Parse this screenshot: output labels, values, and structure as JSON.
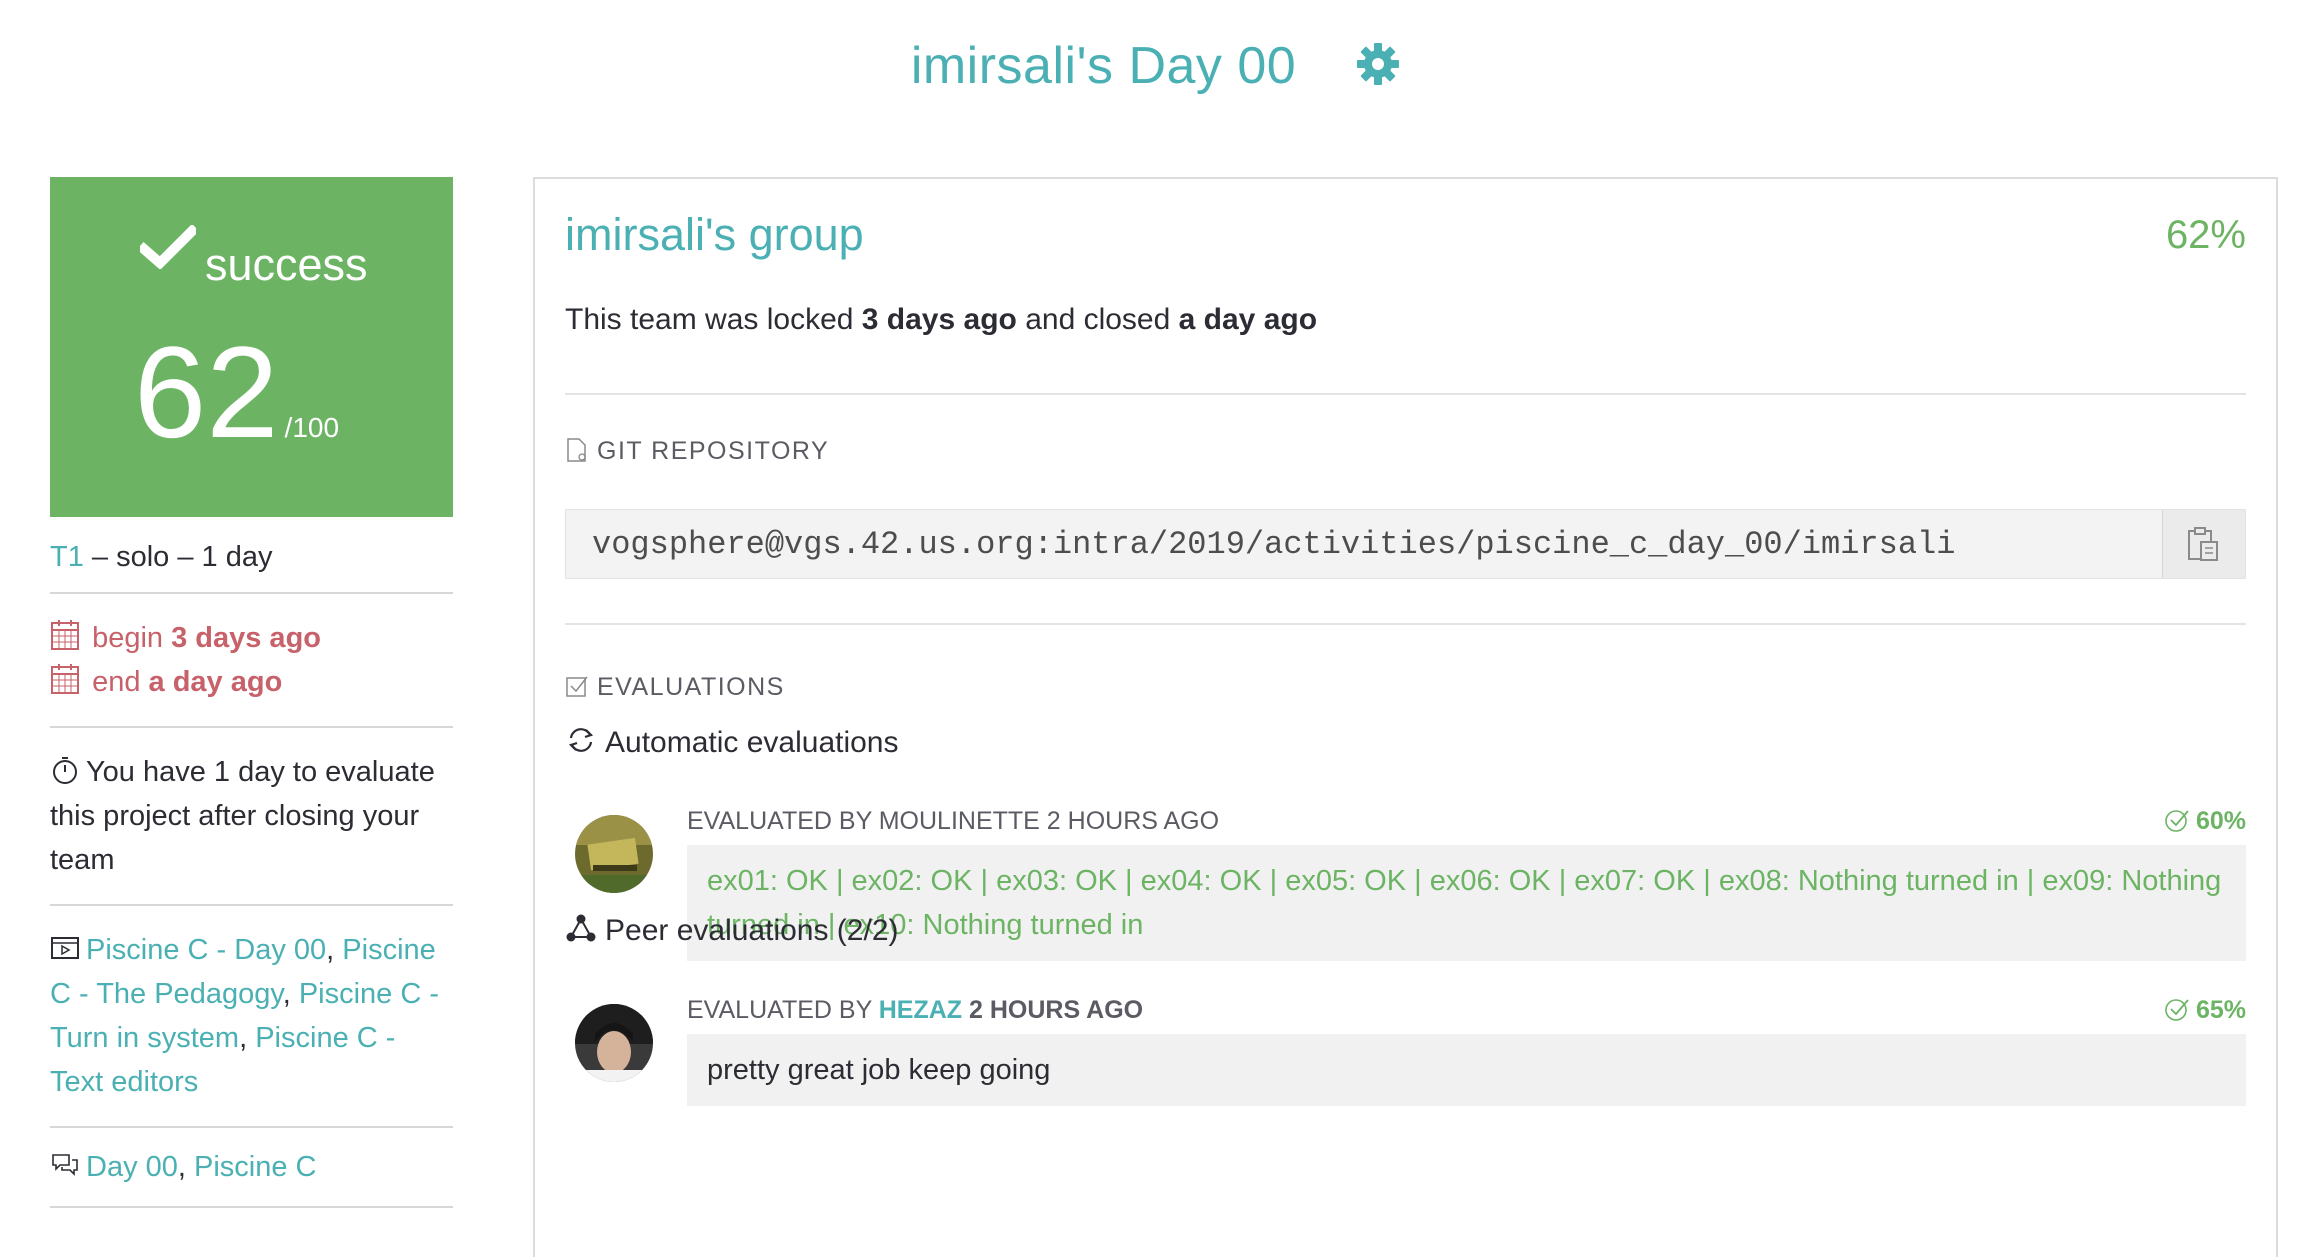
{
  "header": {
    "title": "imirsali's Day 00",
    "settings_icon": "gear-icon"
  },
  "status": {
    "label": "success",
    "score": "62",
    "out_of": "/100",
    "color": "#6cb464"
  },
  "project_info": {
    "tier": "T1",
    "details": " – solo – 1 day",
    "begin_label": "begin",
    "begin_value": "3 days ago",
    "end_label": "end",
    "end_value": "a day ago",
    "evaluate_notice": "You have 1 day to evaluate this project after closing your team",
    "videos": [
      {
        "label": "Piscine C - Day 00"
      },
      {
        "label": "Piscine C - The Pedagogy"
      },
      {
        "label": "Piscine C - Turn in system"
      },
      {
        "label": "Piscine C - Text editors"
      }
    ],
    "forums": [
      {
        "label": "Day 00"
      },
      {
        "label": "Piscine C"
      }
    ]
  },
  "team": {
    "name": "imirsali's group",
    "percent": "62%",
    "locked_prefix": "This team was locked ",
    "locked_time": "3 days ago",
    "closed_prefix": " and closed ",
    "closed_time": "a day ago"
  },
  "git": {
    "heading": "GIT REPOSITORY",
    "url": "vogsphere@vgs.42.us.org:intra/2019/activities/piscine_c_day_00/imirsali"
  },
  "evaluations": {
    "heading": "EVALUATIONS",
    "automatic_heading": "Automatic evaluations",
    "automatic": {
      "by_prefix": "EVALUATED BY MOULINETTE 2 HOURS AGO",
      "score": "60%",
      "result": "ex01: OK | ex02: OK | ex03: OK | ex04: OK | ex05: OK | ex06: OK | ex07: OK | ex08: Nothing turned in | ex09: Nothing turned in | ex10: Nothing turned in"
    },
    "peer_heading": "Peer evaluations (2/2)",
    "peer": {
      "by_prefix": "EVALUATED BY ",
      "evaluator": "HEZAZ",
      "time": " 2 HOURS AGO",
      "score": "65%",
      "comment": "pretty great job keep going"
    }
  }
}
